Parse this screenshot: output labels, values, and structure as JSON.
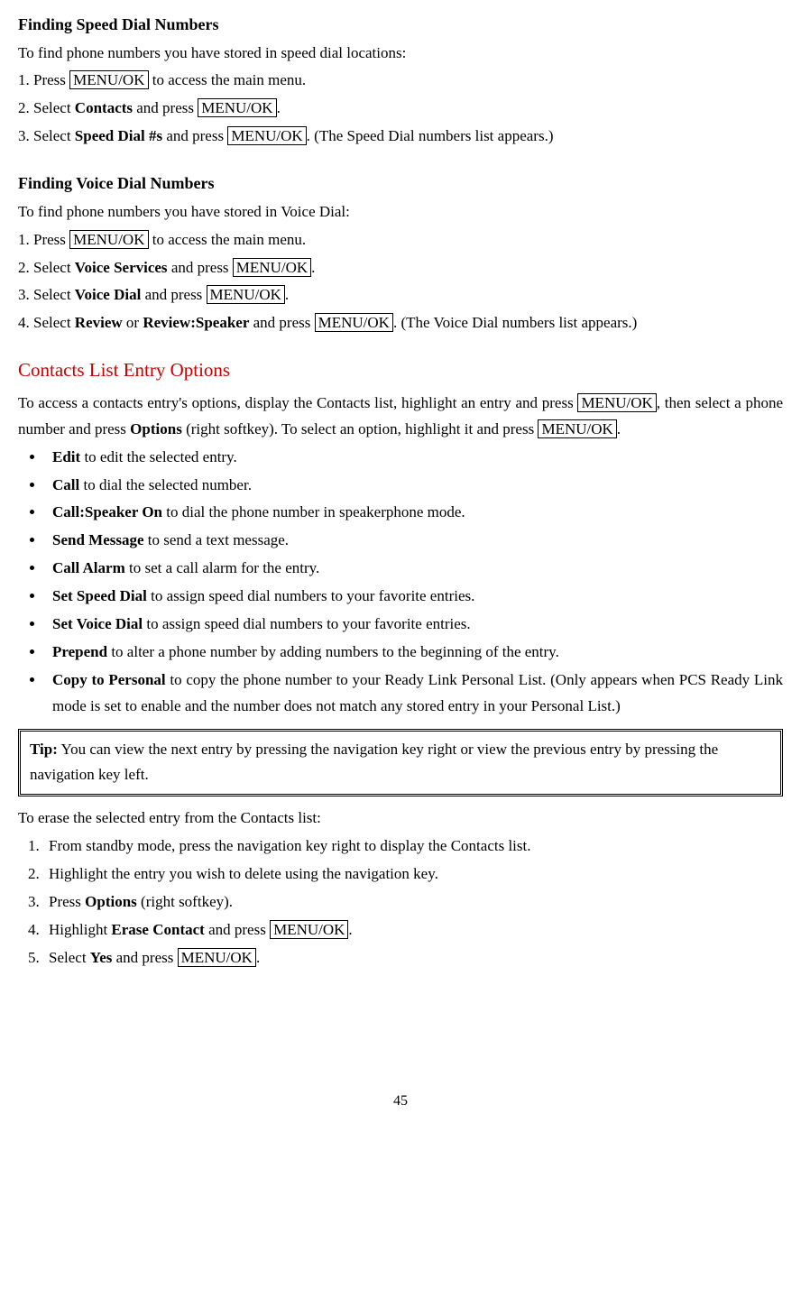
{
  "sec1": {
    "title": "Finding Speed Dial Numbers",
    "intro": "To find phone numbers you have stored in speed dial locations:",
    "s1a": "1. Press ",
    "s1key": "MENU/OK",
    "s1b": " to access the main menu.",
    "s2a": "2. Select ",
    "s2bold": "Contacts",
    "s2b": " and press ",
    "s2key": "MENU/OK",
    "s2c": ".",
    "s3a": "3. Select ",
    "s3bold": "Speed Dial #s",
    "s3b": " and press ",
    "s3key": "MENU/OK",
    "s3c": ". (The Speed Dial numbers list appears.)"
  },
  "sec2": {
    "title": "Finding Voice Dial Numbers",
    "intro": "To find phone numbers you have stored in Voice Dial:",
    "s1a": "1. Press ",
    "s1key": "MENU/OK",
    "s1b": " to access the main menu.",
    "s2a": "2. Select ",
    "s2bold": "Voice Services",
    "s2b": " and press ",
    "s2key": "MENU/OK",
    "s2c": ".",
    "s3a": "3. Select ",
    "s3bold": "Voice Dial",
    "s3b": " and press ",
    "s3key": "MENU/OK",
    "s3c": ".",
    "s4a": "4. Select ",
    "s4bold1": "Review",
    "s4or": " or ",
    "s4bold2": "Review:Speaker",
    "s4b": " and press ",
    "s4key": "MENU/OK",
    "s4c": ". (The Voice Dial numbers list appears.)"
  },
  "sec3": {
    "title": "Contacts List Entry Options",
    "p1a": "To access a contacts entry's options, display the Contacts list, highlight an entry and press ",
    "p1key1": "MENU/OK",
    "p1b": ", then select a phone number and press ",
    "p1bold": "Options",
    "p1c": " (right softkey). To select an option, highlight it and press ",
    "p1key2": "MENU/OK",
    "p1d": ".",
    "b1a": "Edit",
    "b1b": " to edit the selected entry.",
    "b2a": "Call",
    "b2b": " to dial the selected number.",
    "b3a": "Call:Speaker On",
    "b3b": " to dial the phone number in speakerphone mode.",
    "b4a": "Send Message",
    "b4b": " to send a text message.",
    "b5a": "Call Alarm",
    "b5b": " to set a call alarm for the entry.",
    "b6a": "Set Speed Dial",
    "b6b": " to assign speed dial numbers to your favorite entries.",
    "b7a": "Set Voice Dial",
    "b7b": " to assign speed dial numbers to your favorite entries.",
    "b8a": "Prepend",
    "b8b": " to alter a phone number by adding numbers to the beginning of the entry.",
    "b9a": "Copy to Personal",
    "b9b": " to copy the phone number to your Ready Link Personal List. (Only appears when PCS Ready Link mode is set to enable and the number does not match any stored entry in your Personal List.)",
    "tipLabel": "Tip:",
    "tipText": " You can view the next entry by pressing the navigation key right or view the previous entry by pressing the navigation key left.",
    "eraseIntro": "To erase the selected entry from the Contacts list:",
    "e1": "From standby mode, press the navigation key right to display the Contacts list.",
    "e2": "Highlight the entry you wish to delete using the navigation key.",
    "e3a": "Press ",
    "e3bold": "Options",
    "e3b": " (right softkey).",
    "e4a": "Highlight ",
    "e4bold": "Erase Contact",
    "e4b": " and press ",
    "e4key": "MENU/OK",
    "e4c": ".",
    "e5a": "Select ",
    "e5bold": "Yes",
    "e5b": " and press ",
    "e5key": "MENU/OK",
    "e5c": "."
  },
  "pageNumber": "45"
}
